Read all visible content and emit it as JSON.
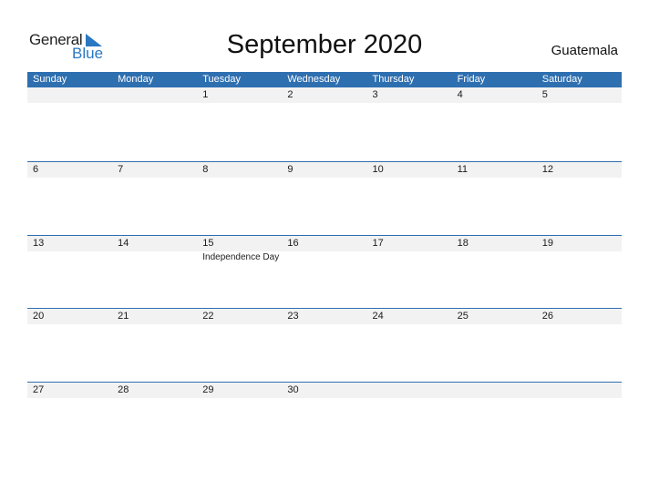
{
  "brand": {
    "word1": "General",
    "word2": "Blue",
    "accent": "#2a78c2"
  },
  "title": "September 2020",
  "country": "Guatemala",
  "colors": {
    "header_bg": "#2e6fb0",
    "date_strip_bg": "#f2f2f2"
  },
  "weekdays": [
    "Sunday",
    "Monday",
    "Tuesday",
    "Wednesday",
    "Thursday",
    "Friday",
    "Saturday"
  ],
  "weeks": [
    {
      "days": [
        "",
        "",
        "1",
        "2",
        "3",
        "4",
        "5"
      ],
      "events": [
        "",
        "",
        "",
        "",
        "",
        "",
        ""
      ]
    },
    {
      "days": [
        "6",
        "7",
        "8",
        "9",
        "10",
        "11",
        "12"
      ],
      "events": [
        "",
        "",
        "",
        "",
        "",
        "",
        ""
      ]
    },
    {
      "days": [
        "13",
        "14",
        "15",
        "16",
        "17",
        "18",
        "19"
      ],
      "events": [
        "",
        "",
        "Independence Day",
        "",
        "",
        "",
        ""
      ]
    },
    {
      "days": [
        "20",
        "21",
        "22",
        "23",
        "24",
        "25",
        "26"
      ],
      "events": [
        "",
        "",
        "",
        "",
        "",
        "",
        ""
      ]
    },
    {
      "days": [
        "27",
        "28",
        "29",
        "30",
        "",
        "",
        ""
      ],
      "events": [
        "",
        "",
        "",
        "",
        "",
        "",
        ""
      ]
    }
  ]
}
